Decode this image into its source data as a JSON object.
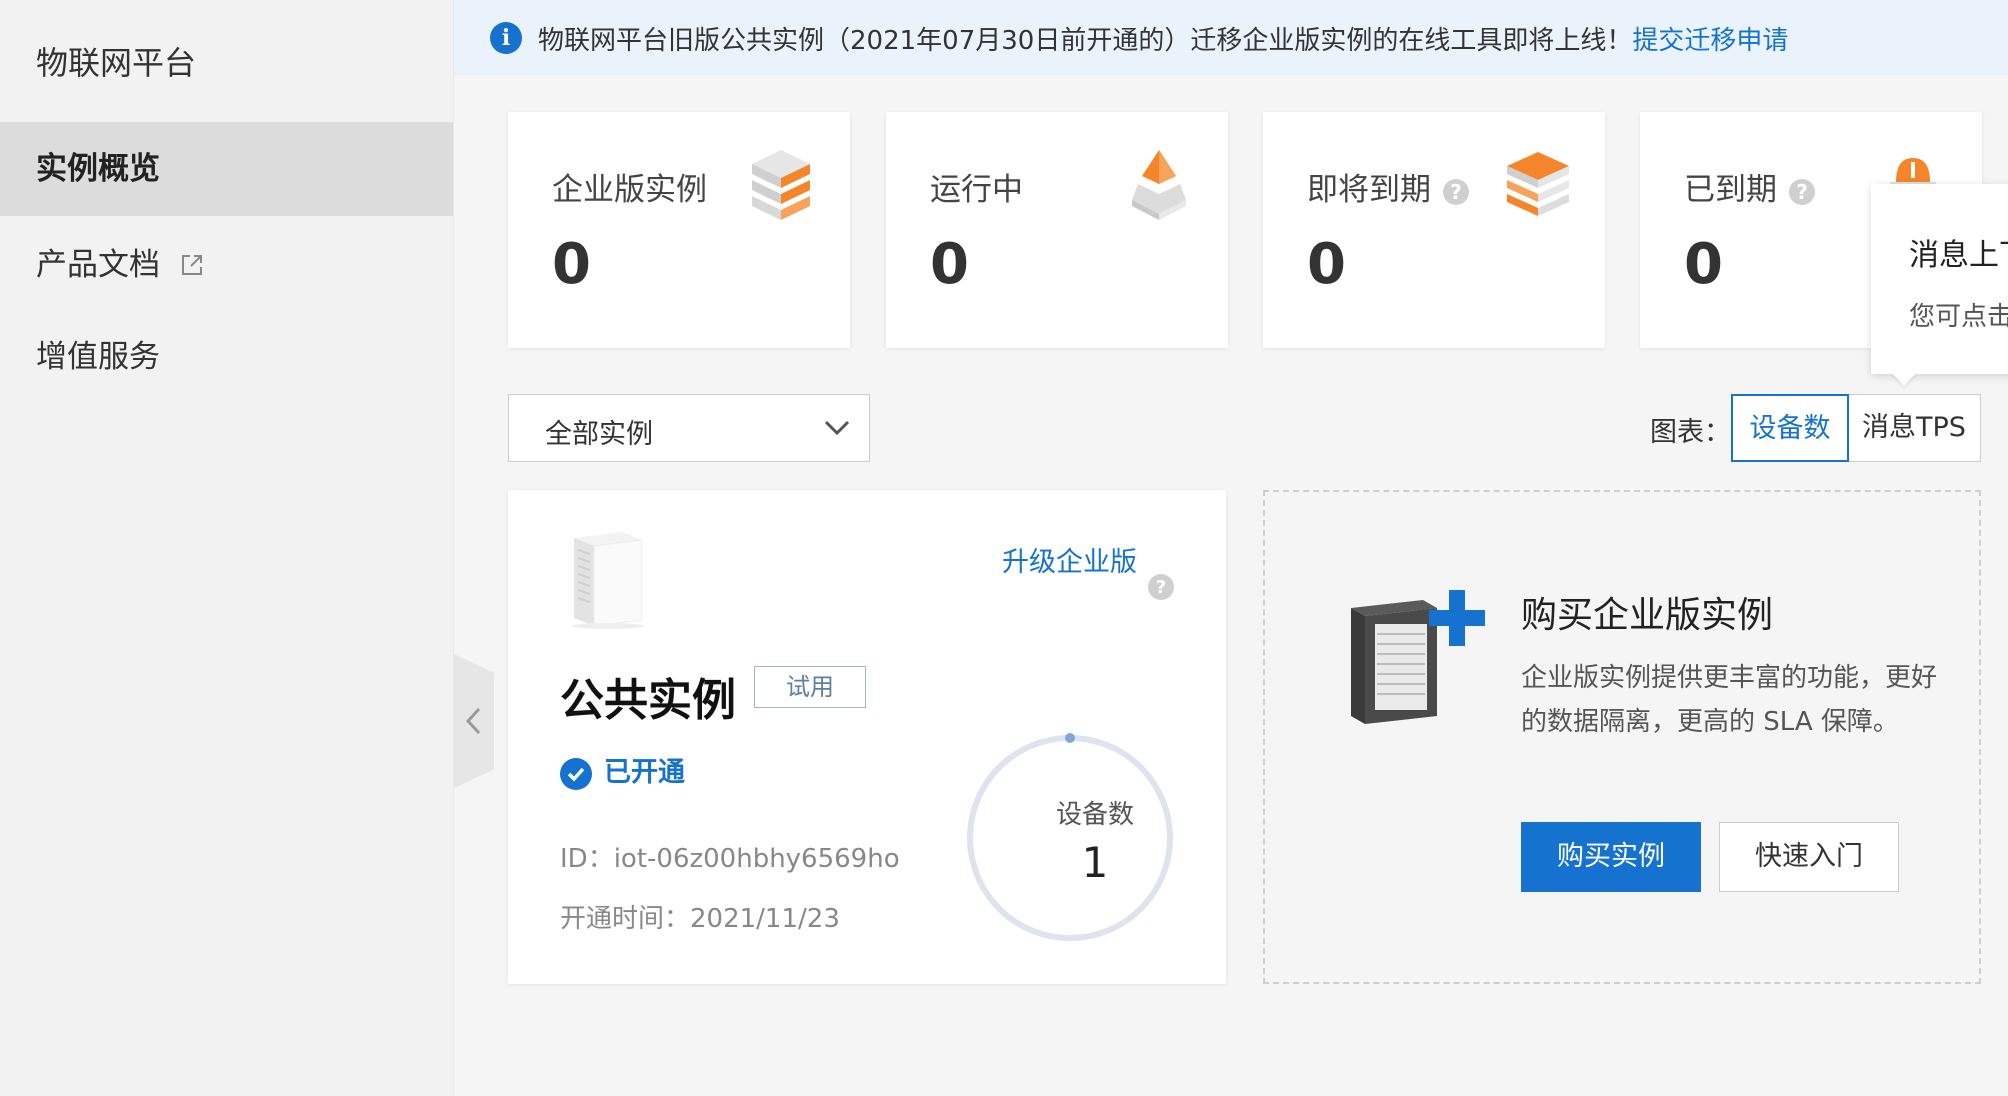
{
  "sidebar": {
    "title": "物联网平台",
    "items": [
      {
        "label": "实例概览",
        "active": true
      },
      {
        "label": "产品文档",
        "external": true
      },
      {
        "label": "增值服务"
      }
    ]
  },
  "banner": {
    "icon": "info-icon",
    "text": "物联网平台旧版公共实例（2021年07月30日前开通的）迁移企业版实例的在线工具即将上线！",
    "link": "提交迁移申请"
  },
  "stats": [
    {
      "label": "企业版实例",
      "value": "0",
      "icon": "enterprise-stack-icon",
      "help": false
    },
    {
      "label": "运行中",
      "value": "0",
      "icon": "running-pyramid-icon",
      "help": false
    },
    {
      "label": "即将到期",
      "value": "0",
      "icon": "expiring-stack-icon",
      "help": true
    },
    {
      "label": "已到期",
      "value": "0",
      "icon": "expired-icon",
      "help": true
    }
  ],
  "tooltip": {
    "title": "消息上下",
    "text": "您可点击"
  },
  "filter": {
    "selected": "全部实例"
  },
  "chart_toggle": {
    "label": "图表：",
    "options": [
      "设备数",
      "消息TPS"
    ],
    "selected": "设备数"
  },
  "instance_card": {
    "upgrade_link": "升级企业版",
    "title": "公共实例",
    "tag": "试用",
    "status": "已开通",
    "id_text": "ID：iot-06z00hbhy6569ho",
    "date_text": "开通时间：2021/11/23",
    "ring_label": "设备数",
    "ring_value": "1"
  },
  "buy_card": {
    "title": "购买企业版实例",
    "description": "企业版实例提供更丰富的功能，更好的数据隔离，更高的 SLA 保障。",
    "primary_button": "购买实例",
    "secondary_button": "快速入门"
  },
  "colors": {
    "primary": "#1572cf",
    "orange": "#f5852a",
    "banner_bg": "#eaf3fb"
  }
}
